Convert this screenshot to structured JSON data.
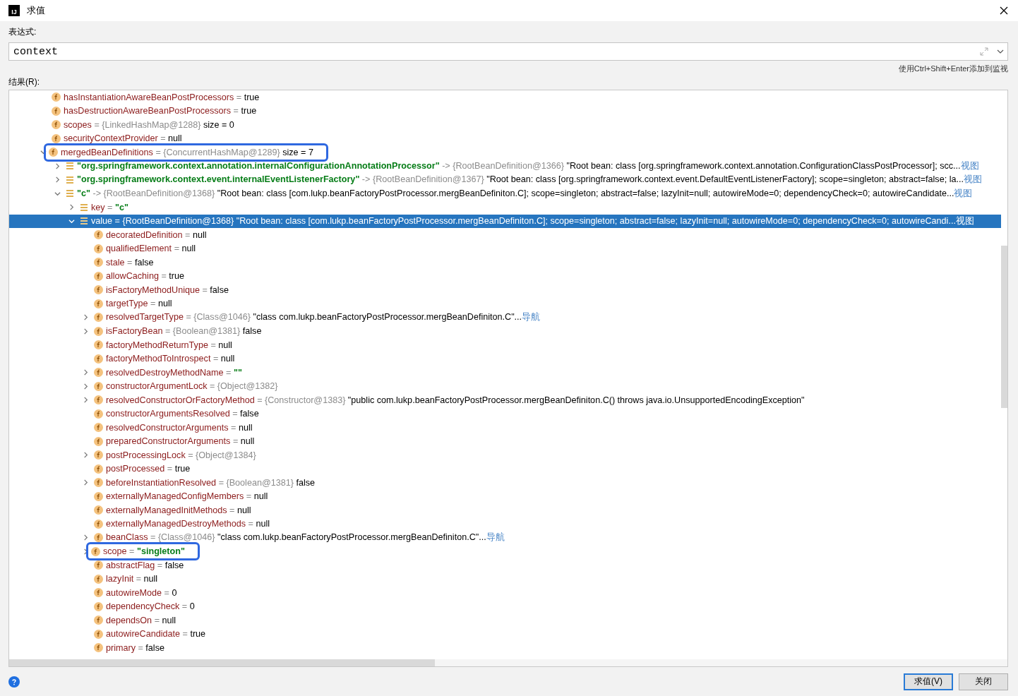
{
  "window": {
    "logo": "IJ",
    "title": "求值"
  },
  "expression": {
    "label": "表达式:",
    "value": "context",
    "hint": "使用Ctrl+Shift+Enter添加到监视"
  },
  "result": {
    "label": "结果(R):",
    "tree": [
      {
        "kind": "field",
        "name": "hasInstantiationAwareBeanPostProcessors",
        "sep": "=",
        "value": "true",
        "selected": false
      },
      {
        "kind": "field",
        "name": "hasDestructionAwareBeanPostProcessors",
        "sep": "=",
        "value": "true",
        "selected": false
      },
      {
        "kind": "field",
        "name": "scopes",
        "sep": "=",
        "ref": "{LinkedHashMap@1288}",
        "value": "size = 0",
        "selected": false
      },
      {
        "kind": "field",
        "name": "securityContextProvider",
        "sep": "=",
        "value": "null",
        "selected": false
      },
      {
        "kind": "field",
        "name": "mergedBeanDefinitions",
        "sep": "=",
        "ref": "{ConcurrentHashMap@1289}",
        "value": "size = 7",
        "selected": false,
        "expanded": true,
        "highlighted": true,
        "children": [
          {
            "kind": "map-entry",
            "name": "\"org.springframework.context.annotation.internalConfigurationAnnotationProcessor\"",
            "sep": "->",
            "ref": "{RootBeanDefinition@1366}",
            "value": "\"Root bean: class [org.springframework.context.annotation.ConfigurationClassPostProcessor]; scc...",
            "link": "视图",
            "selected": false,
            "expanded": false
          },
          {
            "kind": "map-entry",
            "name": "\"org.springframework.context.event.internalEventListenerFactory\"",
            "sep": "->",
            "ref": "{RootBeanDefinition@1367}",
            "value": "\"Root bean: class [org.springframework.context.event.DefaultEventListenerFactory]; scope=singleton; abstract=false; la...",
            "link": "视图",
            "selected": false,
            "expanded": false
          },
          {
            "kind": "map-entry",
            "name": "\"c\"",
            "sep": "->",
            "ref": "{RootBeanDefinition@1368}",
            "value": "\"Root bean: class [com.lukp.beanFactoryPostProcessor.mergBeanDefiniton.C]; scope=singleton; abstract=false; lazyInit=null; autowireMode=0; dependencyCheck=0; autowireCandidate...",
            "link": "视图",
            "selected": false,
            "expanded": true,
            "children": [
              {
                "kind": "entry-part",
                "name": "key",
                "sep": "=",
                "value": "\"c\"",
                "is_string": true,
                "selected": false,
                "expanded": false
              },
              {
                "kind": "entry-part",
                "name": "value",
                "sep": "=",
                "ref": "{RootBeanDefinition@1368}",
                "value": "\"Root bean: class [com.lukp.beanFactoryPostProcessor.mergBeanDefiniton.C]; scope=singleton; abstract=false; lazyInit=null; autowireMode=0; dependencyCheck=0; autowireCandi...",
                "link": "视图",
                "selected": true,
                "expanded": true,
                "children": [
                  {
                    "kind": "field",
                    "name": "decoratedDefinition",
                    "sep": "=",
                    "value": "null",
                    "selected": false
                  },
                  {
                    "kind": "field",
                    "name": "qualifiedElement",
                    "sep": "=",
                    "value": "null",
                    "selected": false
                  },
                  {
                    "kind": "field",
                    "name": "stale",
                    "sep": "=",
                    "value": "false",
                    "selected": false
                  },
                  {
                    "kind": "field",
                    "name": "allowCaching",
                    "sep": "=",
                    "value": "true",
                    "selected": false
                  },
                  {
                    "kind": "field",
                    "name": "isFactoryMethodUnique",
                    "sep": "=",
                    "value": "false",
                    "selected": false
                  },
                  {
                    "kind": "field",
                    "name": "targetType",
                    "sep": "=",
                    "value": "null",
                    "selected": false
                  },
                  {
                    "kind": "field",
                    "name": "resolvedTargetType",
                    "sep": "=",
                    "ref": "{Class@1046}",
                    "value": "\"class com.lukp.beanFactoryPostProcessor.mergBeanDefiniton.C\"...",
                    "link": "导航",
                    "selected": false,
                    "expanded": false
                  },
                  {
                    "kind": "field",
                    "name": "isFactoryBean",
                    "sep": "=",
                    "ref": "{Boolean@1381}",
                    "value": "false",
                    "selected": false,
                    "expanded": false
                  },
                  {
                    "kind": "field",
                    "name": "factoryMethodReturnType",
                    "sep": "=",
                    "value": "null",
                    "selected": false
                  },
                  {
                    "kind": "field",
                    "name": "factoryMethodToIntrospect",
                    "sep": "=",
                    "value": "null",
                    "selected": false
                  },
                  {
                    "kind": "field",
                    "name": "resolvedDestroyMethodName",
                    "sep": "=",
                    "value": "\"\"",
                    "is_string": true,
                    "selected": false,
                    "expanded": false
                  },
                  {
                    "kind": "field",
                    "name": "constructorArgumentLock",
                    "sep": "=",
                    "ref": "{Object@1382}",
                    "selected": false,
                    "expanded": false
                  },
                  {
                    "kind": "field",
                    "name": "resolvedConstructorOrFactoryMethod",
                    "sep": "=",
                    "ref": "{Constructor@1383}",
                    "value": "\"public com.lukp.beanFactoryPostProcessor.mergBeanDefiniton.C() throws java.io.UnsupportedEncodingException\"",
                    "selected": false,
                    "expanded": false
                  },
                  {
                    "kind": "field",
                    "name": "constructorArgumentsResolved",
                    "sep": "=",
                    "value": "false",
                    "selected": false
                  },
                  {
                    "kind": "field",
                    "name": "resolvedConstructorArguments",
                    "sep": "=",
                    "value": "null",
                    "selected": false
                  },
                  {
                    "kind": "field",
                    "name": "preparedConstructorArguments",
                    "sep": "=",
                    "value": "null",
                    "selected": false
                  },
                  {
                    "kind": "field",
                    "name": "postProcessingLock",
                    "sep": "=",
                    "ref": "{Object@1384}",
                    "selected": false,
                    "expanded": false
                  },
                  {
                    "kind": "field",
                    "name": "postProcessed",
                    "sep": "=",
                    "value": "true",
                    "selected": false
                  },
                  {
                    "kind": "field",
                    "name": "beforeInstantiationResolved",
                    "sep": "=",
                    "ref": "{Boolean@1381}",
                    "value": "false",
                    "selected": false,
                    "expanded": false
                  },
                  {
                    "kind": "field",
                    "name": "externallyManagedConfigMembers",
                    "sep": "=",
                    "value": "null",
                    "selected": false
                  },
                  {
                    "kind": "field",
                    "name": "externallyManagedInitMethods",
                    "sep": "=",
                    "value": "null",
                    "selected": false
                  },
                  {
                    "kind": "field",
                    "name": "externallyManagedDestroyMethods",
                    "sep": "=",
                    "value": "null",
                    "selected": false
                  },
                  {
                    "kind": "field",
                    "name": "beanClass",
                    "sep": "=",
                    "ref": "{Class@1046}",
                    "value": "\"class com.lukp.beanFactoryPostProcessor.mergBeanDefiniton.C\"...",
                    "link": "导航",
                    "selected": false,
                    "expanded": false
                  },
                  {
                    "kind": "field",
                    "name": "scope",
                    "sep": "=",
                    "value": "\"singleton\"",
                    "is_string": true,
                    "selected": false,
                    "expanded": false,
                    "highlighted": true
                  },
                  {
                    "kind": "field",
                    "name": "abstractFlag",
                    "sep": "=",
                    "value": "false",
                    "selected": false
                  },
                  {
                    "kind": "field",
                    "name": "lazyInit",
                    "sep": "=",
                    "value": "null",
                    "selected": false
                  },
                  {
                    "kind": "field",
                    "name": "autowireMode",
                    "sep": "=",
                    "value": "0",
                    "selected": false
                  },
                  {
                    "kind": "field",
                    "name": "dependencyCheck",
                    "sep": "=",
                    "value": "0",
                    "selected": false
                  },
                  {
                    "kind": "field",
                    "name": "dependsOn",
                    "sep": "=",
                    "value": "null",
                    "selected": false
                  },
                  {
                    "kind": "field",
                    "name": "autowireCandidate",
                    "sep": "=",
                    "value": "true",
                    "selected": false
                  },
                  {
                    "kind": "field",
                    "name": "primary",
                    "sep": "=",
                    "value": "false",
                    "selected": false
                  }
                ]
              }
            ]
          }
        ]
      }
    ]
  },
  "buttons": [
    {
      "label": "求值(V)",
      "focused": true
    },
    {
      "label": "关闭",
      "focused": false
    }
  ]
}
